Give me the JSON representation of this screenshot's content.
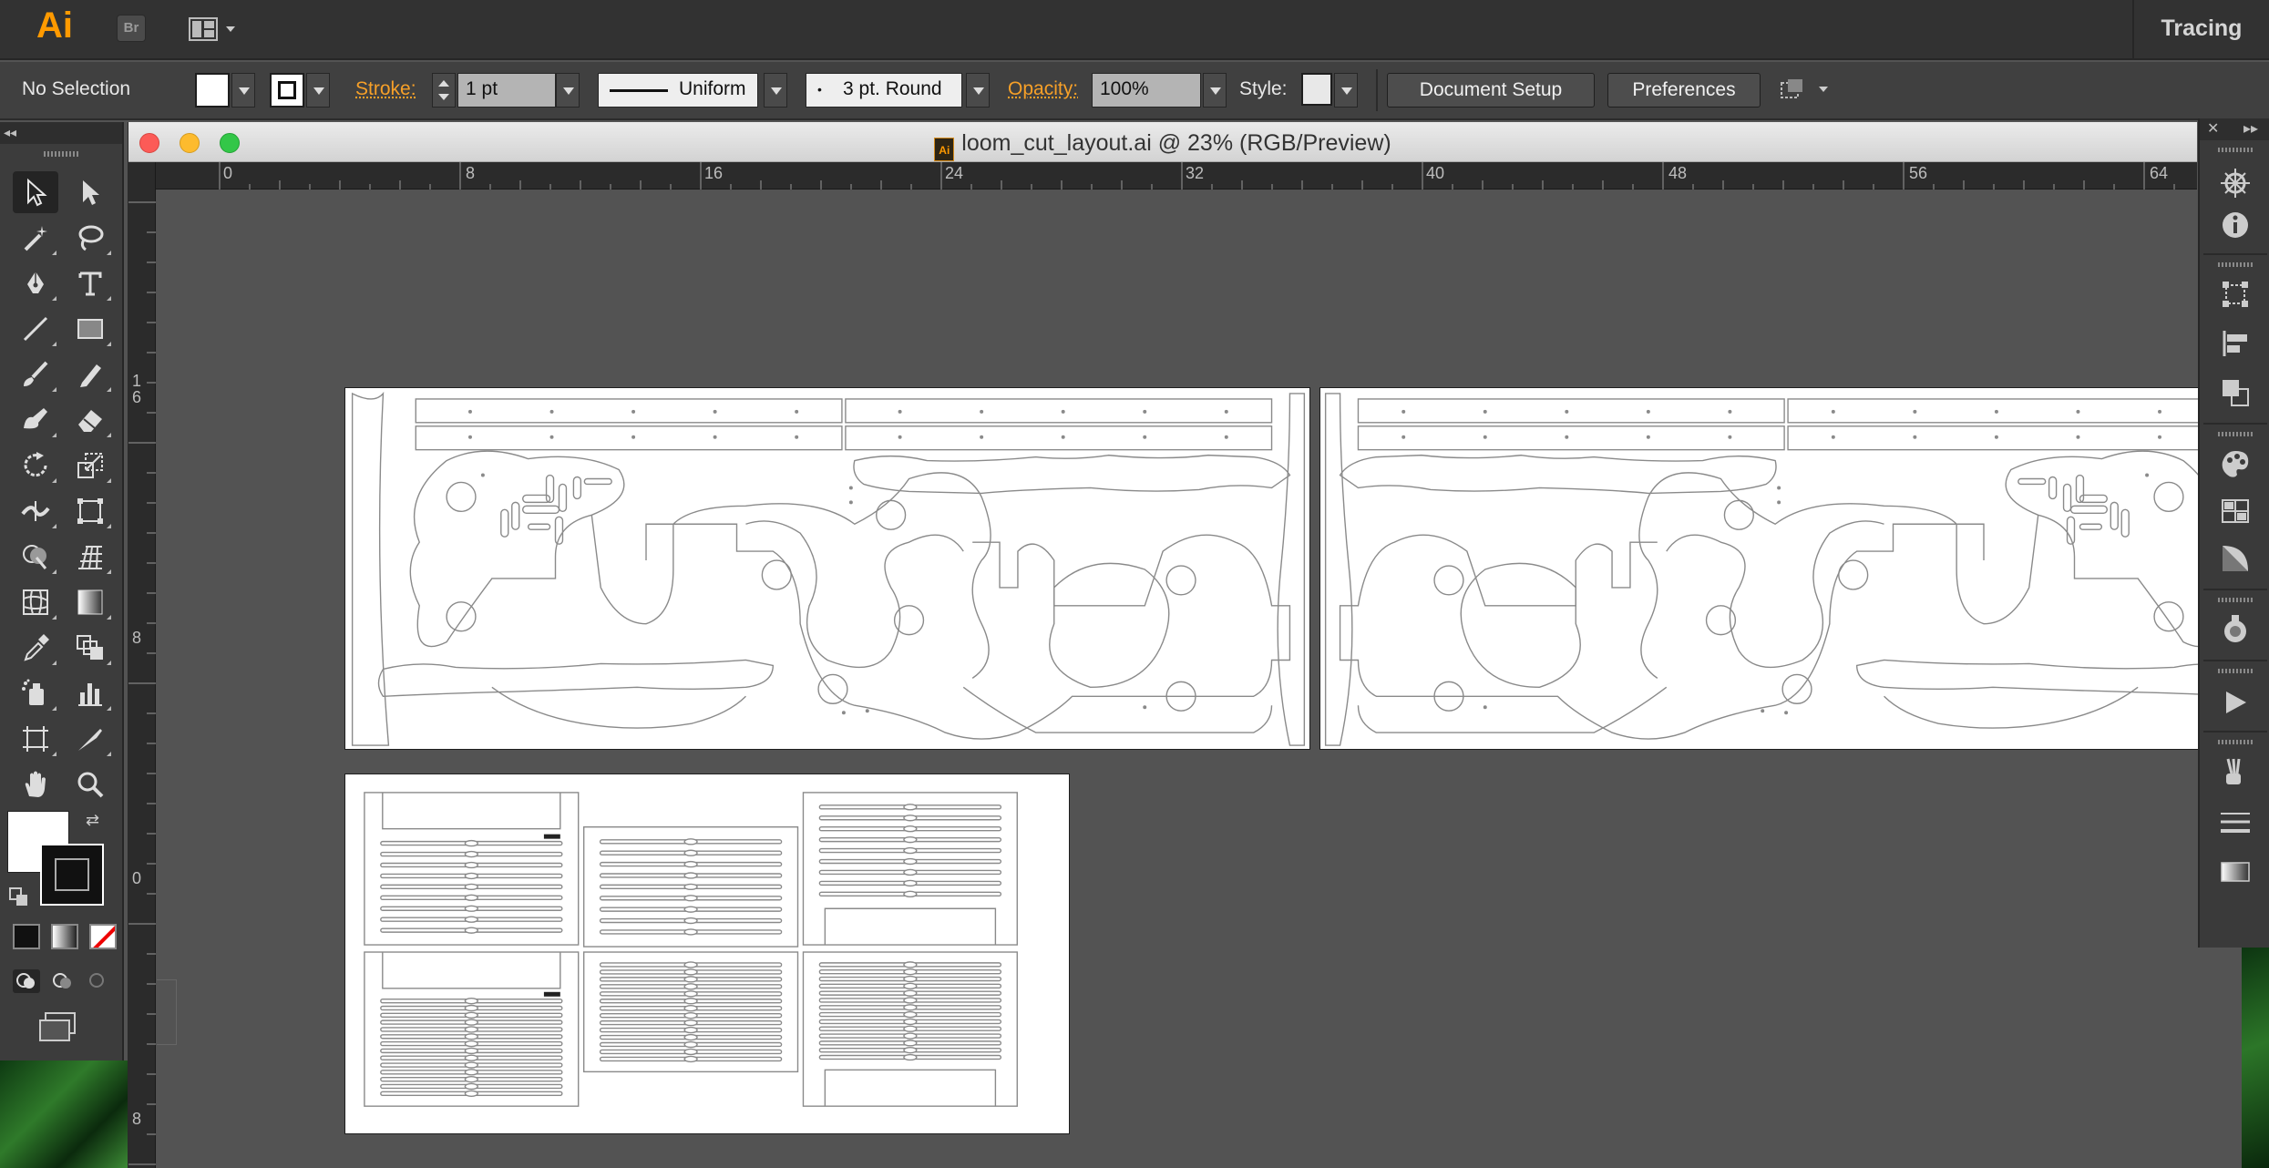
{
  "app": {
    "logo": "Ai",
    "bridge_label": "Br",
    "workspace": "Tracing"
  },
  "control_bar": {
    "selection_label": "No Selection",
    "stroke_label": "Stroke:",
    "stroke_value": "1 pt",
    "profile_value": "Uniform",
    "brush_value": "3 pt. Round",
    "opacity_label": "Opacity:",
    "opacity_value": "100%",
    "style_label": "Style:",
    "document_setup_label": "Document Setup",
    "preferences_label": "Preferences"
  },
  "tools_panel": {
    "collapse_label": "◂◂",
    "tools": [
      "selection-tool",
      "direct-selection-tool",
      "magic-wand-tool",
      "lasso-tool",
      "pen-tool",
      "type-tool",
      "line-segment-tool",
      "rectangle-tool",
      "paintbrush-tool",
      "pencil-tool",
      "blob-brush-tool",
      "eraser-tool",
      "rotate-tool",
      "scale-tool",
      "width-tool",
      "free-transform-tool",
      "shape-builder-tool",
      "perspective-grid-tool",
      "mesh-tool",
      "gradient-tool",
      "eyedropper-tool",
      "blend-tool",
      "symbol-sprayer-tool",
      "column-graph-tool",
      "artboard-tool",
      "slice-tool",
      "hand-tool",
      "zoom-tool"
    ]
  },
  "document": {
    "title": "loom_cut_layout.ai @ 23% (RGB/Preview)",
    "icon_label": "Ai",
    "ruler_h": [
      "0",
      "8",
      "16",
      "24",
      "32",
      "40",
      "48",
      "56",
      "64"
    ],
    "ruler_v": [
      "1",
      "6",
      "8",
      "0",
      "8"
    ]
  },
  "right_dock": {
    "top_labels": [
      "✕",
      "▸▸"
    ],
    "panels": [
      "navigator-icon",
      "info-icon",
      "transform-icon",
      "align-icon",
      "pathfinder-icon",
      "color-guide-icon",
      "swatches-icon",
      "gradient-panel-icon",
      "appearance-icon",
      "actions-icon",
      "brushes-icon",
      "stroke-icon",
      "transparency-icon"
    ]
  },
  "colors": {
    "accent": "#f7a028",
    "ai_orange": "#ff9a00",
    "canvas": "#535353",
    "artboard": "#ffffff"
  }
}
